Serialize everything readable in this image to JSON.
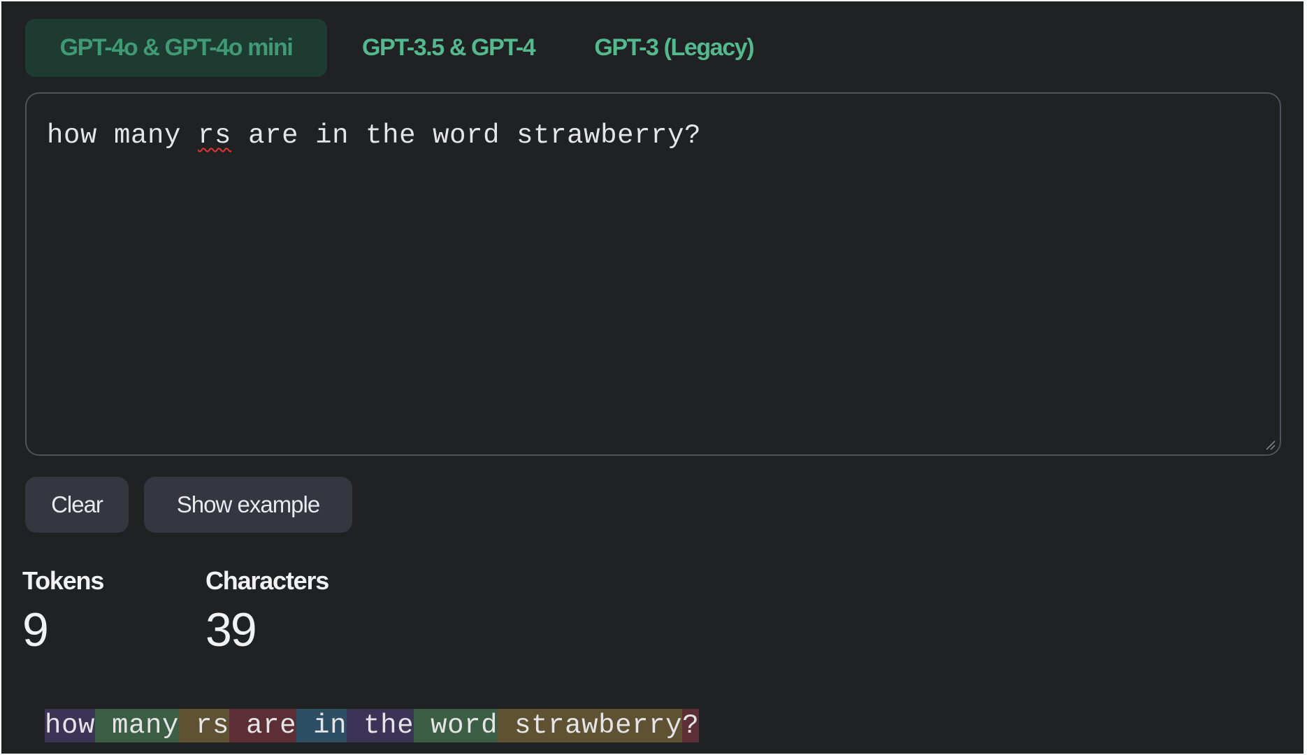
{
  "tabs": [
    {
      "label": "GPT-4o & GPT-4o mini",
      "active": true
    },
    {
      "label": "GPT-3.5 & GPT-4",
      "active": false
    },
    {
      "label": "GPT-3 (Legacy)",
      "active": false
    }
  ],
  "input": {
    "before_flagged": "how many ",
    "flagged_word": "rs",
    "after_flagged": " are in the word strawberry?"
  },
  "buttons": {
    "clear_label": "Clear",
    "show_example_label": "Show example"
  },
  "stats": {
    "tokens_label": "Tokens",
    "tokens_value": "9",
    "characters_label": "Characters",
    "characters_value": "39"
  },
  "tokens": [
    {
      "text": "how",
      "color": "#3b3457"
    },
    {
      "text": " many",
      "color": "#3c5e45"
    },
    {
      "text": " rs",
      "color": "#5e5233"
    },
    {
      "text": " are",
      "color": "#5b2f35"
    },
    {
      "text": " in",
      "color": "#2e4f63"
    },
    {
      "text": " the",
      "color": "#3b3457"
    },
    {
      "text": " word",
      "color": "#3c5e45"
    },
    {
      "text": " strawberry",
      "color": "#5e5233"
    },
    {
      "text": "?",
      "color": "#5b2f35"
    }
  ],
  "colors": {
    "background": "#202123",
    "accent_green": "#55b98e",
    "active_tab_bg": "#1e3b32",
    "button_bg": "#343640"
  }
}
